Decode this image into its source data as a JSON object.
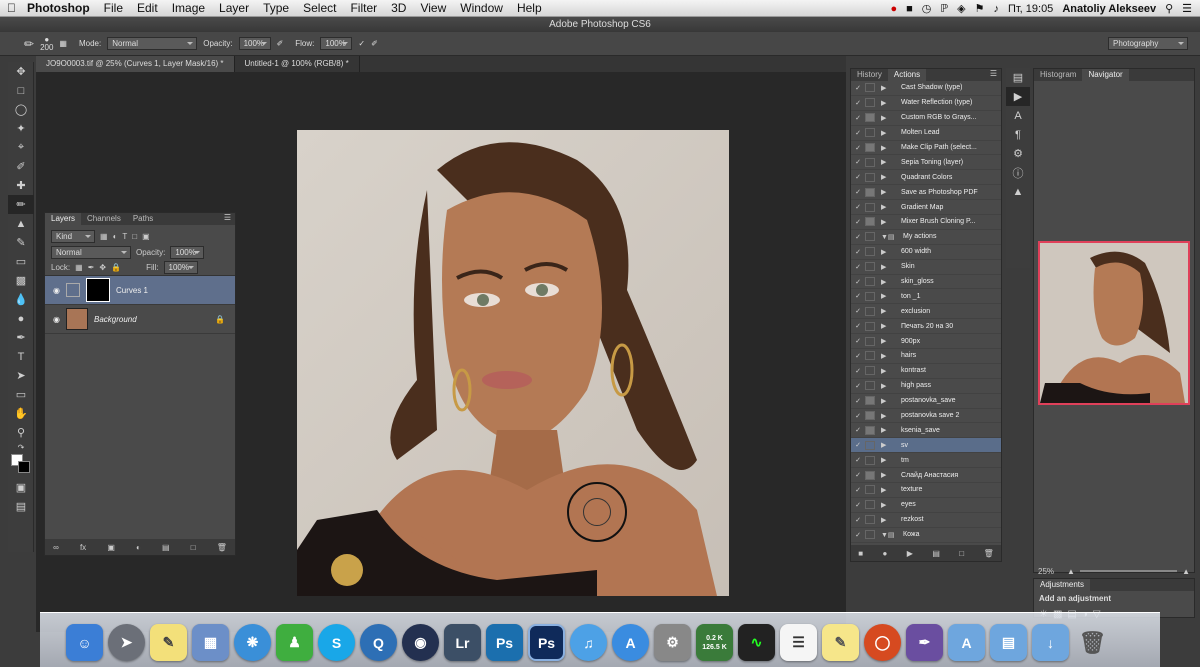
{
  "menubar": {
    "apple_icon": "apple-icon",
    "app": "Photoshop",
    "items": [
      "File",
      "Edit",
      "Image",
      "Layer",
      "Type",
      "Select",
      "Filter",
      "3D",
      "View",
      "Window",
      "Help"
    ],
    "clock": "Пт, 19:05",
    "user": "Anatoliy Alekseev"
  },
  "window": {
    "title": "Adobe Photoshop CS6"
  },
  "options": {
    "brush_size": "200",
    "mode_label": "Mode:",
    "mode": "Normal",
    "opacity_label": "Opacity:",
    "opacity": "100%",
    "flow_label": "Flow:",
    "flow": "100%",
    "workspace": "Photography"
  },
  "doc_tabs": [
    "JO9O0003.tif @ 25% (Curves 1, Layer Mask/16) *",
    "Untitled-1 @ 100% (RGB/8) *"
  ],
  "layers_panel": {
    "tabs": [
      "Layers",
      "Channels",
      "Paths"
    ],
    "kind": "Kind",
    "blend": "Normal",
    "opacity_label": "Opacity:",
    "opacity": "100%",
    "lock_label": "Lock:",
    "fill_label": "Fill:",
    "fill": "100%",
    "layers": [
      {
        "name": "Curves 1"
      },
      {
        "name": "Background"
      }
    ]
  },
  "actions_panel": {
    "tabs": [
      "History",
      "Actions"
    ],
    "items": [
      {
        "label": "Cast Shadow (type)",
        "kind": "action",
        "mark": false
      },
      {
        "label": "Water Reflection (type)",
        "kind": "action",
        "mark": false
      },
      {
        "label": "Custom RGB to Grays...",
        "kind": "action",
        "mark": true
      },
      {
        "label": "Molten Lead",
        "kind": "action",
        "mark": false
      },
      {
        "label": "Make Clip Path (select...",
        "kind": "action",
        "mark": true
      },
      {
        "label": "Sepia Toning (layer)",
        "kind": "action",
        "mark": false
      },
      {
        "label": "Quadrant Colors",
        "kind": "action",
        "mark": false
      },
      {
        "label": "Save as Photoshop PDF",
        "kind": "action",
        "mark": true
      },
      {
        "label": "Gradient Map",
        "kind": "action",
        "mark": false
      },
      {
        "label": "Mixer Brush Cloning P...",
        "kind": "action",
        "mark": true
      },
      {
        "label": "My actions",
        "kind": "set",
        "mark": false
      },
      {
        "label": "600 width",
        "kind": "action",
        "mark": false
      },
      {
        "label": "Skin",
        "kind": "action",
        "mark": false
      },
      {
        "label": "skin_gloss",
        "kind": "action",
        "mark": false
      },
      {
        "label": "ton _1",
        "kind": "action",
        "mark": false
      },
      {
        "label": "exclusion",
        "kind": "action",
        "mark": false
      },
      {
        "label": "Печать 20 на 30",
        "kind": "action",
        "mark": false
      },
      {
        "label": "900px",
        "kind": "action",
        "mark": false
      },
      {
        "label": "hairs",
        "kind": "action",
        "mark": false
      },
      {
        "label": "kontrast",
        "kind": "action",
        "mark": false
      },
      {
        "label": "high pass",
        "kind": "action",
        "mark": false
      },
      {
        "label": "postanovka_save",
        "kind": "action",
        "mark": true
      },
      {
        "label": "postanovka save 2",
        "kind": "action",
        "mark": true
      },
      {
        "label": "ksenia_save",
        "kind": "action",
        "mark": true
      },
      {
        "label": "sv",
        "kind": "action",
        "mark": false,
        "selected": true
      },
      {
        "label": "tm",
        "kind": "action",
        "mark": false
      },
      {
        "label": "Слайд Анастасия",
        "kind": "action",
        "mark": true
      },
      {
        "label": "texture",
        "kind": "action",
        "mark": false
      },
      {
        "label": "eyes",
        "kind": "action",
        "mark": false
      },
      {
        "label": "rezkost",
        "kind": "action",
        "mark": false
      },
      {
        "label": "Кожа",
        "kind": "set",
        "mark": false
      }
    ]
  },
  "navigator": {
    "tabs": [
      "Histogram",
      "Navigator"
    ],
    "zoom": "25%"
  },
  "adjustments": {
    "title": "Adjustments",
    "subtitle": "Add an adjustment"
  },
  "dock": {
    "ps_label": "Ps",
    "lr_label": "Lr",
    "net_up": "0.2 K",
    "net_down": "126.5 K"
  },
  "colors": {
    "accent": "#e0405a",
    "selection": "#5a6d8a"
  }
}
